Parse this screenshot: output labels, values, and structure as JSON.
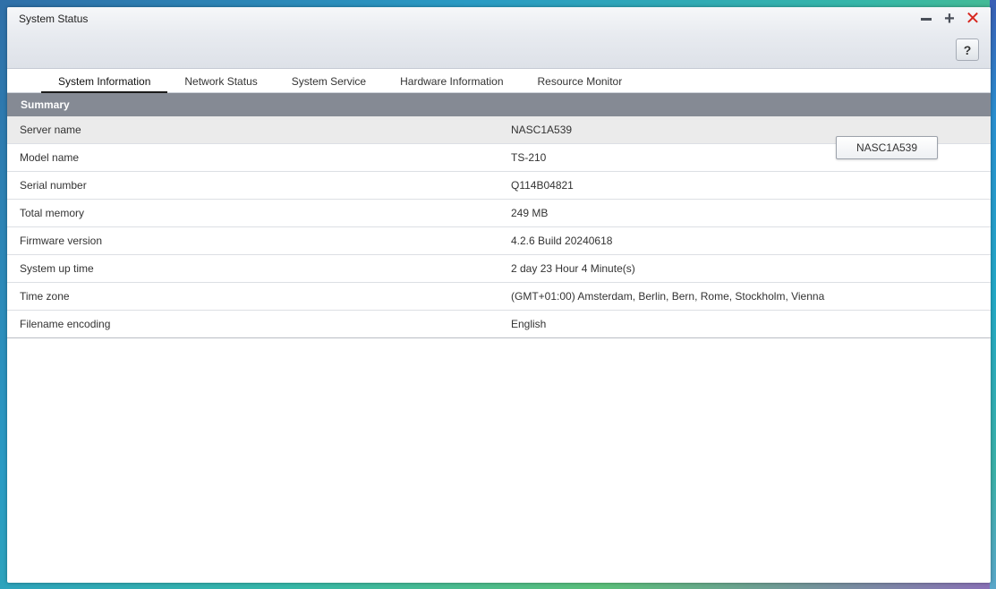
{
  "window": {
    "title": "System Status",
    "help_label": "?"
  },
  "tabs": [
    {
      "label": "System Information",
      "active": true
    },
    {
      "label": "Network Status",
      "active": false
    },
    {
      "label": "System Service",
      "active": false
    },
    {
      "label": "Hardware Information",
      "active": false
    },
    {
      "label": "Resource Monitor",
      "active": false
    }
  ],
  "summary": {
    "header": "Summary",
    "rows": [
      {
        "label": "Server name",
        "value": "NASC1A539"
      },
      {
        "label": "Model name",
        "value": "TS-210"
      },
      {
        "label": "Serial number",
        "value": "Q114B04821"
      },
      {
        "label": "Total memory",
        "value": "249 MB"
      },
      {
        "label": "Firmware version",
        "value": "4.2.6 Build 20240618"
      },
      {
        "label": "System up time",
        "value": "2 day 23 Hour 4 Minute(s)"
      },
      {
        "label": "Time zone",
        "value": "(GMT+01:00) Amsterdam, Berlin, Bern, Rome, Stockholm, Vienna"
      },
      {
        "label": "Filename encoding",
        "value": "English"
      }
    ]
  },
  "tooltip": {
    "text": "NASC1A539"
  },
  "colors": {
    "close": "#d7261e",
    "section_header_bg": "#858a94",
    "highlight_row_bg": "#ebebeb"
  }
}
